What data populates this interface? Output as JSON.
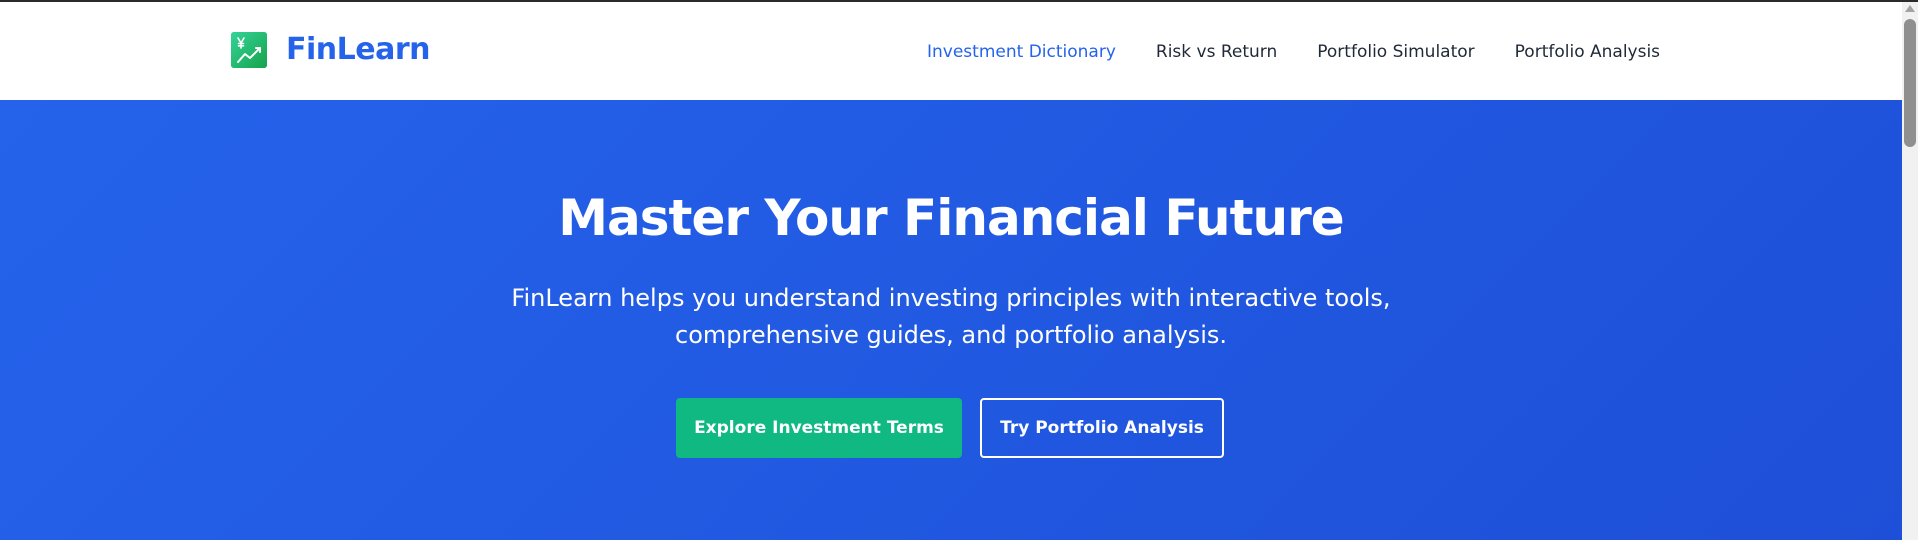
{
  "brand": {
    "name": "FinLearn",
    "icon": "yen-growth-chart-icon",
    "icon_color": "#22c55e",
    "name_color": "#2563eb"
  },
  "nav": {
    "items": [
      {
        "label": "Investment Dictionary",
        "active": true
      },
      {
        "label": "Risk vs Return",
        "active": false
      },
      {
        "label": "Portfolio Simulator",
        "active": false
      },
      {
        "label": "Portfolio Analysis",
        "active": false
      }
    ],
    "active_color": "#2563eb",
    "text_color": "#1f2937"
  },
  "hero": {
    "title": "Master Your Financial Future",
    "description": "FinLearn helps you understand investing principles with interactive tools, comprehensive guides, and portfolio analysis.",
    "background_color": "#2563eb",
    "primary_button": {
      "label": "Explore Investment Terms",
      "color": "#10b981"
    },
    "secondary_button": {
      "label": "Try Portfolio Analysis"
    }
  }
}
